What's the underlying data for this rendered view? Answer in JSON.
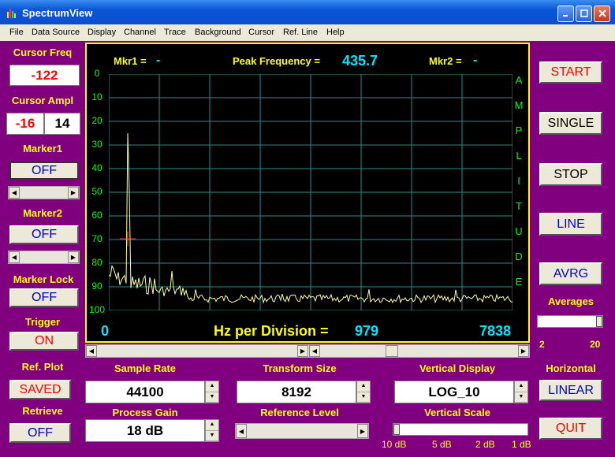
{
  "window": {
    "title": "SpectrumView"
  },
  "menu": [
    "File",
    "Data Source",
    "Display",
    "Channel",
    "Trace",
    "Background",
    "Cursor",
    "Ref. Line",
    "Help"
  ],
  "left": {
    "cursor_freq_label": "Cursor Freq",
    "cursor_freq_value": "-122",
    "cursor_ampl_label": "Cursor Ampl",
    "cursor_ampl_value1": "-16",
    "cursor_ampl_value2": "14",
    "marker1_label": "Marker1",
    "marker1_value": "OFF",
    "marker2_label": "Marker2",
    "marker2_value": "OFF",
    "marker_lock_label": "Marker Lock",
    "marker_lock_value": "OFF",
    "trigger_label": "Trigger",
    "trigger_value": "ON",
    "ref_plot_label": "Ref. Plot",
    "ref_plot_value": "SAVED",
    "retrieve_label": "Retrieve",
    "retrieve_value": "OFF"
  },
  "scope": {
    "mkr1_label": "Mkr1 =",
    "mkr1_value": "-",
    "peak_label": "Peak Frequency =",
    "peak_value": "435.7",
    "mkr2_label": "Mkr2 =",
    "mkr2_value": "-",
    "x_start": "0",
    "hz_per_div_label": "Hz per Division =",
    "hz_per_div_value": "979",
    "x_end": "7838",
    "amplitude_letters": [
      "A",
      "M",
      "P",
      "L",
      "I",
      "T",
      "U",
      "D",
      "E"
    ],
    "y_ticks": [
      "0",
      "10",
      "20",
      "30",
      "40",
      "50",
      "60",
      "70",
      "80",
      "90",
      "100"
    ],
    "trace_color": "#ffffa0",
    "grid_color": "#2a8a8a"
  },
  "right": {
    "start": "START",
    "single": "SINGLE",
    "stop": "STOP",
    "line": "LINE",
    "avrg": "AVRG",
    "averages_label": "Averages",
    "averages_min": "2",
    "averages_max": "20",
    "averages_level": 1.0,
    "horizontal_label": "Horizontal",
    "horizontal_value": "LINEAR",
    "quit": "QUIT"
  },
  "bottom": {
    "sample_rate_label": "Sample Rate",
    "sample_rate_value": "44100",
    "transform_size_label": "Transform Size",
    "transform_size_value": "8192",
    "vertical_display_label": "Vertical Display",
    "vertical_display_value": "LOG_10",
    "process_gain_label": "Process Gain",
    "process_gain_value": "18 dB",
    "reference_level_label": "Reference Level",
    "vertical_scale_label": "Vertical Scale",
    "vertical_scale_ticks": [
      "10 dB",
      "5 dB",
      "2 dB",
      "1 dB"
    ],
    "vertical_scale_level": 0.0
  }
}
